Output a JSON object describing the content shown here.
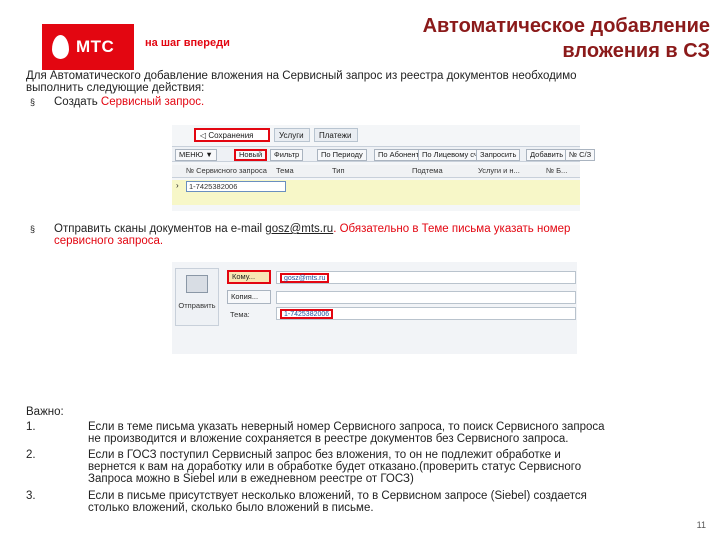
{
  "logo": {
    "text": "МТС",
    "slogan": "на шаг впереди"
  },
  "title": {
    "line1": "Автоматическое добавление",
    "line2": "вложения в СЗ"
  },
  "intro": {
    "line1": "Для Автоматического добавление вложения на Сервисный запрос из реестра документов необходимо",
    "line2": "выполнить следующие действия:"
  },
  "step1": {
    "bullet": "§",
    "prefix": "Создать ",
    "highlight": "Сервисный запрос."
  },
  "shot1": {
    "tabs": [
      "Сохранения",
      "Услуги",
      "Платежи"
    ],
    "toolbar": [
      "МЕНЮ ▼",
      "Новый",
      "Фильтр",
      "По Периоду",
      "По Абоненту",
      "По Лицевому счету",
      "Запросить",
      "Добавить",
      "№ С/З"
    ],
    "headers": [
      "№ Сервисного запроса",
      "Тема",
      "Тип",
      "Подтема",
      "Услуги и н...",
      "№ Б..."
    ],
    "row_value": "1-7425382006"
  },
  "step2": {
    "bullet": "§",
    "prefix": "Отправить сканы документов на e-mail ",
    "email": "gosz@mts.ru",
    "suffix_red": ". Обязательно в Теме письма указать номер",
    "line2_red": "сервисного запроса."
  },
  "shot2": {
    "send_label": "Отправить",
    "to_label": "Кому...",
    "cc_label": "Копия...",
    "subject_label": "Тема:",
    "to_value": "gosz@mts.ru",
    "subject_value": "1-7425382006"
  },
  "important": {
    "heading": "Важно:",
    "items": [
      {
        "num": "1.",
        "line1": "Если в теме письма указать неверный номер Сервисного запроса, то поиск Сервисного запроса",
        "line2": "не производится и вложение сохраняется в реестре документов без Сервисного запроса."
      },
      {
        "num": "2.",
        "line1": "Если в ГОСЗ поступил Сервисный запрос без вложения, то он не подлежит обработке и",
        "line2": "вернется к вам на доработку или в обработке будет отказано.(проверить статус Сервисного",
        "line3": "Запроса можно в Siebel или в ежедневном реестре от ГОСЗ)"
      },
      {
        "num": "3.",
        "line1": "Если в письме присутствует несколько вложений, то в Сервисном запросе (Siebel) создается",
        "line2": "столько вложений, сколько было вложений в письме."
      }
    ]
  },
  "page_number": "11",
  "colors": {
    "brand_red": "#e30611",
    "title": "#8b1a1a"
  }
}
